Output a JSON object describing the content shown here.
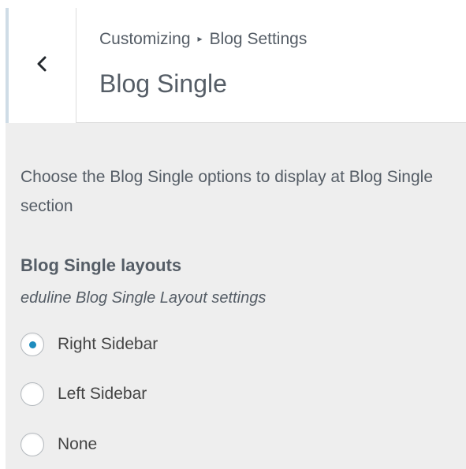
{
  "header": {
    "back_icon": "chevron-left-icon",
    "breadcrumb": {
      "root": "Customizing",
      "separator": "▸",
      "parent": "Blog Settings"
    },
    "title": "Blog Single"
  },
  "section": {
    "description": "Choose the Blog Single options to display at Blog Single section"
  },
  "control": {
    "title": "Blog Single layouts",
    "description": "eduline Blog Single Layout settings",
    "options": [
      {
        "label": "Right Sidebar",
        "checked": true
      },
      {
        "label": "Left Sidebar",
        "checked": false
      },
      {
        "label": "None",
        "checked": false
      }
    ]
  },
  "colors": {
    "accent": "#1e8cbe",
    "panel_bg": "#eeeeee",
    "text": "#555d66"
  }
}
